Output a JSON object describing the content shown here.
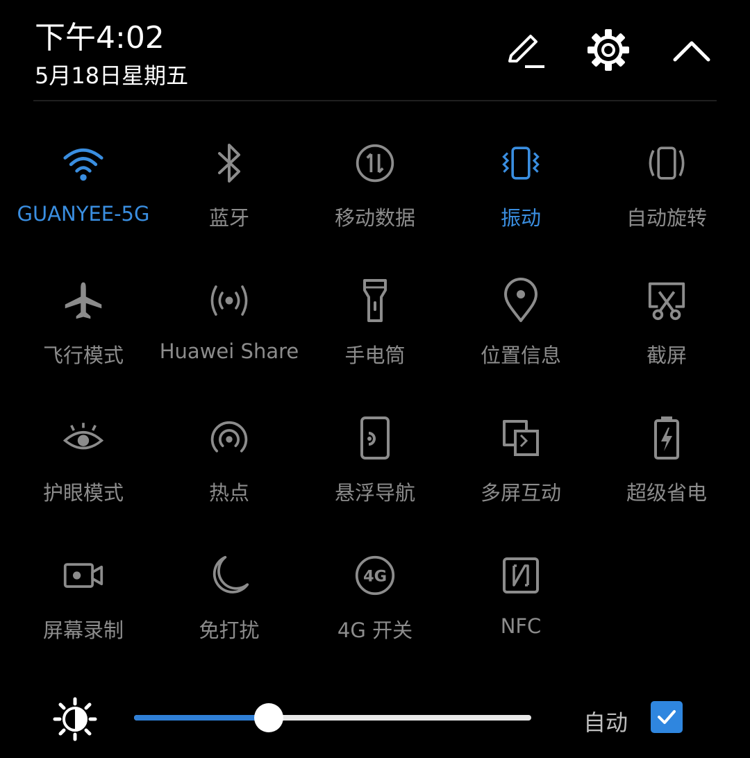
{
  "header": {
    "time": "下午4:02",
    "date": "5月18日星期五",
    "edit_icon": "pencil-icon",
    "settings_icon": "gear-icon",
    "collapse_icon": "chevron-up-icon"
  },
  "colors": {
    "active": "#3a8ee0",
    "inactive": "#8c8c8c",
    "background": "#000000"
  },
  "tiles": [
    {
      "label": "GUANYEE-5G",
      "icon": "wifi-icon",
      "active": true
    },
    {
      "label": "蓝牙",
      "icon": "bluetooth-icon",
      "active": false
    },
    {
      "label": "移动数据",
      "icon": "mobile-data-icon",
      "active": false
    },
    {
      "label": "振动",
      "icon": "vibrate-icon",
      "active": true
    },
    {
      "label": "自动旋转",
      "icon": "auto-rotate-icon",
      "active": false
    },
    {
      "label": "飞行模式",
      "icon": "airplane-icon",
      "active": false
    },
    {
      "label": "Huawei Share",
      "icon": "huawei-share-icon",
      "active": false
    },
    {
      "label": "手电筒",
      "icon": "flashlight-icon",
      "active": false
    },
    {
      "label": "位置信息",
      "icon": "location-icon",
      "active": false
    },
    {
      "label": "截屏",
      "icon": "screenshot-icon",
      "active": false
    },
    {
      "label": "护眼模式",
      "icon": "eye-icon",
      "active": false
    },
    {
      "label": "热点",
      "icon": "hotspot-icon",
      "active": false
    },
    {
      "label": "悬浮导航",
      "icon": "floating-nav-icon",
      "active": false
    },
    {
      "label": "多屏互动",
      "icon": "multi-screen-icon",
      "active": false
    },
    {
      "label": "超级省电",
      "icon": "battery-saver-icon",
      "active": false
    },
    {
      "label": "屏幕录制",
      "icon": "screen-record-icon",
      "active": false
    },
    {
      "label": "免打扰",
      "icon": "moon-icon",
      "active": false
    },
    {
      "label": "4G 开关",
      "icon": "4g-icon",
      "active": false
    },
    {
      "label": "NFC",
      "icon": "nfc-icon",
      "active": false
    }
  ],
  "brightness": {
    "icon": "brightness-icon",
    "level": 0.34,
    "auto_label": "自动",
    "auto_checked": true
  }
}
